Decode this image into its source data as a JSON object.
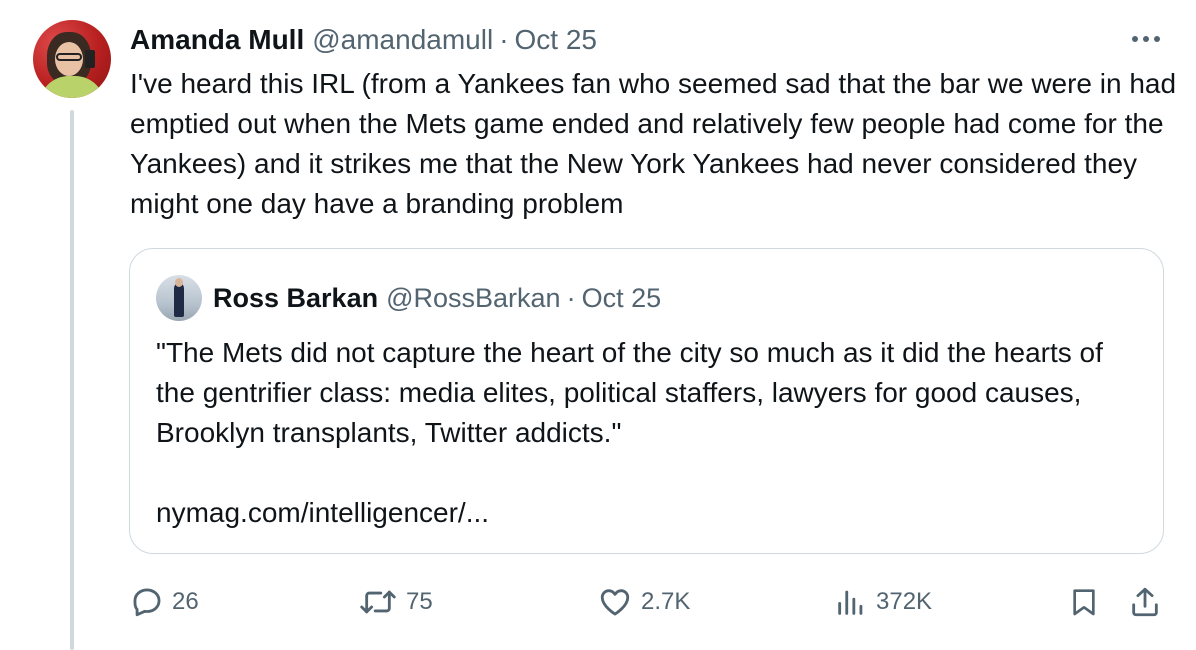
{
  "tweet": {
    "author_name": "Amanda Mull",
    "author_handle": "@amandamull",
    "separator": "·",
    "date": "Oct 25",
    "text": "I've heard this IRL (from a Yankees fan who seemed sad that the bar we were in had emptied out when the Mets game ended and relatively few people had come for the Yankees) and it strikes me that the New York Yankees had never considered they might one day have a branding problem"
  },
  "quote": {
    "author_name": "Ross Barkan",
    "author_handle": "@RossBarkan",
    "separator": "·",
    "date": "Oct 25",
    "text": "\"The Mets did not capture the heart of the city so much as it did the hearts of the gentrifier class: media elites, political staffers, lawyers for good causes, Brooklyn transplants, Twitter addicts.\"",
    "link": "nymag.com/intelligencer/..."
  },
  "actions": {
    "replies": "26",
    "retweets": "75",
    "likes": "2.7K",
    "views": "372K"
  },
  "icons": {
    "more": "more-options-icon",
    "reply": "reply-icon",
    "retweet": "retweet-icon",
    "like": "heart-icon",
    "views": "views-icon",
    "bookmark": "bookmark-icon",
    "share": "share-icon"
  },
  "colors": {
    "text": "#0f1419",
    "secondary": "#536471",
    "border": "#cfd9de"
  }
}
